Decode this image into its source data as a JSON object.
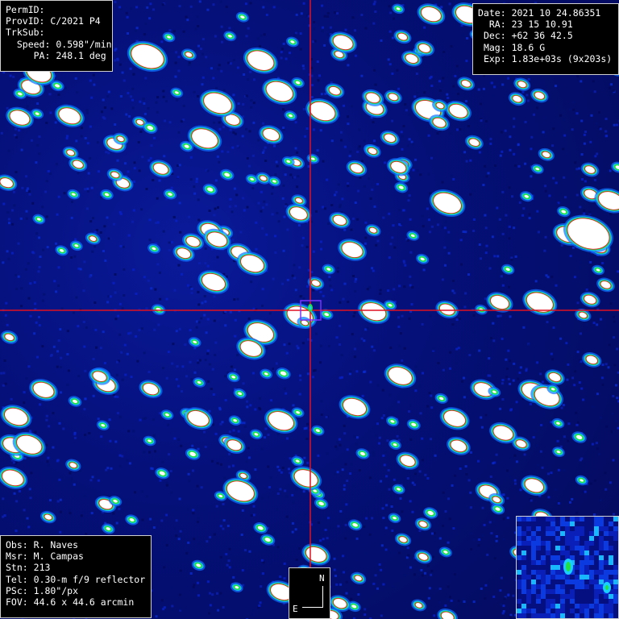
{
  "top_left": {
    "permid_label": "PermID:",
    "permid": "",
    "provid_label": "ProvID:",
    "provid": "C/2021 P4",
    "trksub_label": "TrkSub:",
    "trksub": "",
    "speed_label": "Speed:",
    "speed": "0.598\"/min",
    "pa_label": "PA:",
    "pa": "248.1 deg"
  },
  "top_right": {
    "date_label": "Date:",
    "date": "2021 10 24.86351",
    "ra_label": "RA:",
    "ra": "23 15 10.91",
    "dec_label": "Dec:",
    "dec": "+62 36 42.5",
    "mag_label": "Mag:",
    "mag": "18.6 G",
    "exp_label": "Exp:",
    "exp": "1.83e+03s (9x203s)"
  },
  "bottom_left": {
    "obs_label": "Obs:",
    "obs": "R. Naves",
    "msr_label": "Msr:",
    "msr": "M. Campas",
    "stn_label": "Stn:",
    "stn": "213",
    "tel_label": "Tel:",
    "tel": "0.30-m f/9 reflector",
    "psc_label": "PSc:",
    "psc": "1.80\"/px",
    "fov_label": "FOV:",
    "fov": "44.6 x 44.6 arcmin"
  },
  "compass": {
    "north": "N",
    "east": "E"
  },
  "colors": {
    "crosshair": "#e01020",
    "marker": "#7a30ff",
    "background": "#06118a"
  }
}
